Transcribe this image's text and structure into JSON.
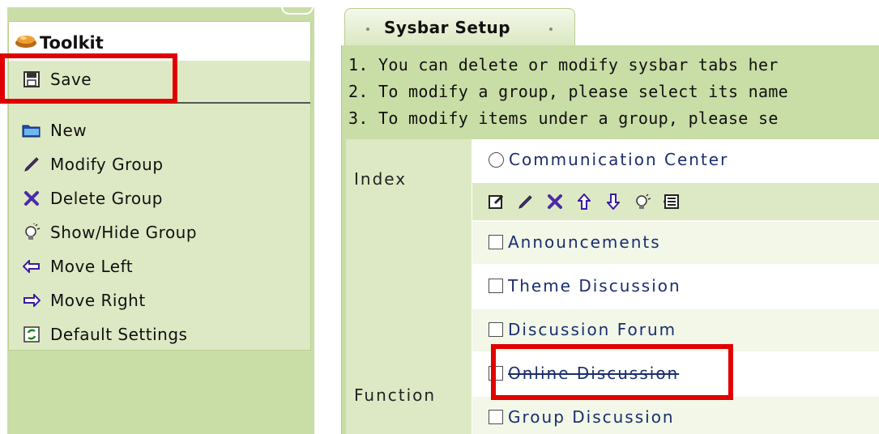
{
  "toolkit": {
    "title": "Toolkit",
    "items": [
      {
        "label": "Save",
        "icon": "save-icon"
      },
      {
        "label": "New",
        "icon": "folder-icon"
      },
      {
        "label": "Modify Group",
        "icon": "pencil-icon"
      },
      {
        "label": "Delete Group",
        "icon": "delete-x-icon"
      },
      {
        "label": "Show/Hide Group",
        "icon": "lightbulb-icon"
      },
      {
        "label": "Move Left",
        "icon": "arrow-left-icon"
      },
      {
        "label": "Move Right",
        "icon": "arrow-right-icon"
      },
      {
        "label": "Default Settings",
        "icon": "refresh-icon"
      }
    ]
  },
  "tab": {
    "label": "Sysbar Setup"
  },
  "notes": [
    "1. You can delete or modify sysbar tabs her",
    "2. To modify a group, please select its name",
    "3. To modify items under a group, please se"
  ],
  "groups": {
    "index_label": "Index",
    "function_label": "Function",
    "index_item": "Communication Center",
    "function_items": [
      {
        "label": "Announcements",
        "strike": false
      },
      {
        "label": "Theme Discussion",
        "strike": false
      },
      {
        "label": "Discussion Forum",
        "strike": false
      },
      {
        "label": "Online Discussion",
        "strike": true
      },
      {
        "label": "Group Discussion",
        "strike": false
      }
    ]
  },
  "colors": {
    "highlight": "#e00000",
    "panel": "#c9dda6",
    "link": "#1a2e6e"
  }
}
